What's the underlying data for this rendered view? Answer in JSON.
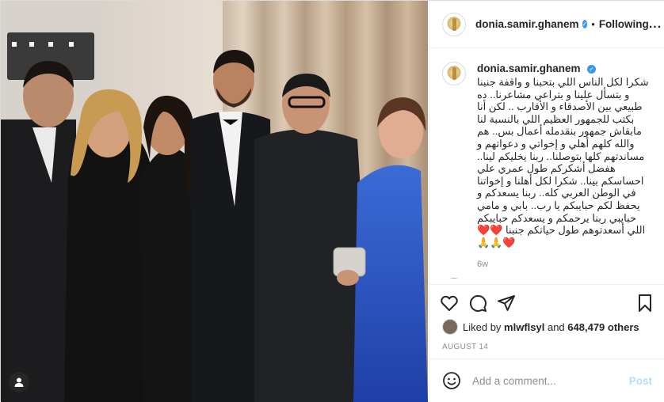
{
  "header": {
    "username": "donia.samir.ghanem",
    "separator": "•",
    "follow_state": "Following",
    "more": "..."
  },
  "caption": {
    "username": "donia.samir.ghanem",
    "text": "شكرا لكل الناس اللي بتحبنا و واقفة جنبنا و بتسأل علينا و بتراعي مشاعرنا.. ده طبيعي بين الأصدقاء و الأقارب .. لكن أنا بكتب للجمهور العظيم اللي بالنسبة لنا مابقاش جمهور بنقدمله أعمال بس.. هم والله كلهم أهلي و إخواتي و دعواتهم و مساندتهم كلها بتوصلنا.. ربنا يخليكم لينا.. هفضل أشكركم طول عمري علي احساسكم بينا.. شكرا لكل أهلنا و إخواتنا في الوطن العربي كله.. ربنا يسعدكم و يحفظ لكم حبايبكم يا رب.. بابي و مامي حبايبي ربنا يرحمكم و يسعدكم حبايبكم اللي أسعدتوهم طول حياتكم جنبنا",
    "emojis": "❤️❤️❤️🙏🙏",
    "age": "6w"
  },
  "likes": {
    "prefix": "Liked by",
    "user": "mlwflsyl",
    "middle": "and",
    "count": "648,479 others"
  },
  "date": "AUGUST 14",
  "add_comment": {
    "placeholder": "Add a comment...",
    "post_label": "Post"
  },
  "icons": [
    "heart-icon",
    "comment-icon",
    "share-icon",
    "bookmark-icon",
    "emoji-icon",
    "user-tag-icon",
    "verified-badge-icon"
  ],
  "colors": {
    "verified": "#3897f0",
    "post_disabled": "#b2dffc",
    "secondary_text": "#8e8e8e",
    "hearts": "#ed4956"
  }
}
